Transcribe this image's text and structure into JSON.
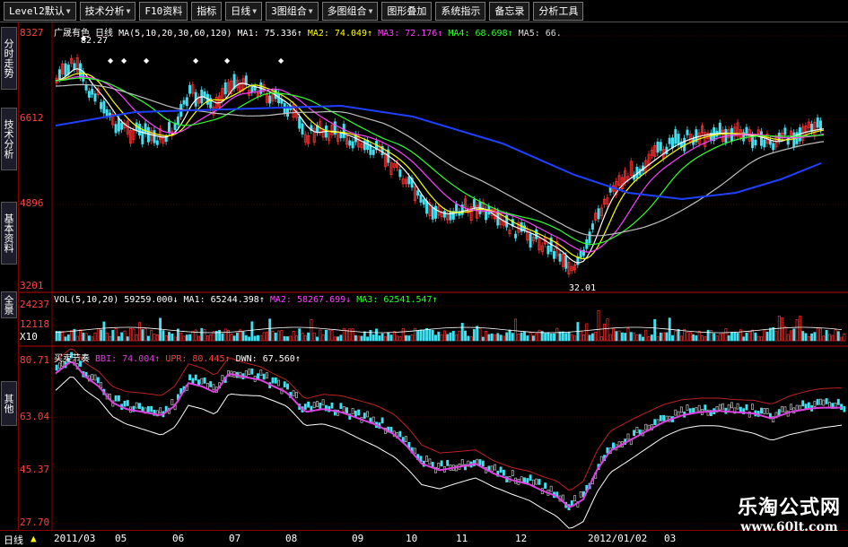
{
  "toolbar": {
    "items": [
      {
        "label": "Level2默认",
        "dropdown": true
      },
      {
        "label": "技术分析",
        "dropdown": true
      },
      {
        "label": "F10资料",
        "dropdown": false
      },
      {
        "label": "指标",
        "dropdown": false
      },
      {
        "label": "日线",
        "dropdown": true
      },
      {
        "label": "3图组合",
        "dropdown": true
      },
      {
        "label": "多图组合",
        "dropdown": true
      },
      {
        "label": "图形叠加",
        "dropdown": false
      },
      {
        "label": "系统指示",
        "dropdown": false
      },
      {
        "label": "备忘录",
        "dropdown": false
      },
      {
        "label": "分析工具",
        "dropdown": false
      }
    ]
  },
  "side_tabs": [
    "分时走势",
    "技术分析",
    "基本资料",
    "全景",
    "其他"
  ],
  "price_panel": {
    "header": "广晟有色 日线",
    "ma_params": "MA(5,10,20,30,60,120)",
    "ma1": "MA1: 75.336↑",
    "ma2": "MA2: 74.049↑",
    "ma3": "MA3: 72.176↑",
    "ma4": "MA4: 68.698↑",
    "ma5": "MA5: 66.",
    "peak_label": "82.27",
    "low_label": "32.01",
    "axis": [
      "8327",
      "6612",
      "4896",
      "3201"
    ]
  },
  "volume_panel": {
    "header": "VOL(5,10,20)",
    "v0": "59259.000↓",
    "ma1": "MA1: 65244.398↑",
    "ma2": "MA2: 58267.699↓",
    "ma3": "MA3: 62541.547↑",
    "axis": [
      "24237",
      "12118",
      "X10"
    ]
  },
  "indicator_panel": {
    "header": "买卖节奏",
    "bbi": "BBI: 74.004↑",
    "upr": "UPR: 80.445↑",
    "dwn": "DWN: 67.560↑",
    "axis": [
      "80.71",
      "63.04",
      "45.37",
      "27.70"
    ]
  },
  "bottom_axis": {
    "period_label": "日线",
    "dates": [
      "2011/03",
      "05",
      "06",
      "07",
      "08",
      "09",
      "10",
      "11",
      "12",
      "2012/01/02",
      "03"
    ]
  },
  "watermark": {
    "title": "乐淘公式网",
    "url": "www.60lt.com"
  },
  "colors": {
    "background": "#000000",
    "up": "#ff3030",
    "down": "#40e0f0",
    "ma_white": "#ffffff",
    "ma_yellow": "#ffff00",
    "ma_magenta": "#ff40ff",
    "ma_green": "#30ff30",
    "ma_blue": "#2040ff",
    "grid": "#880000",
    "bbi": "#e040e0",
    "upr": "#c02020",
    "dwn": "#ffffff"
  }
}
